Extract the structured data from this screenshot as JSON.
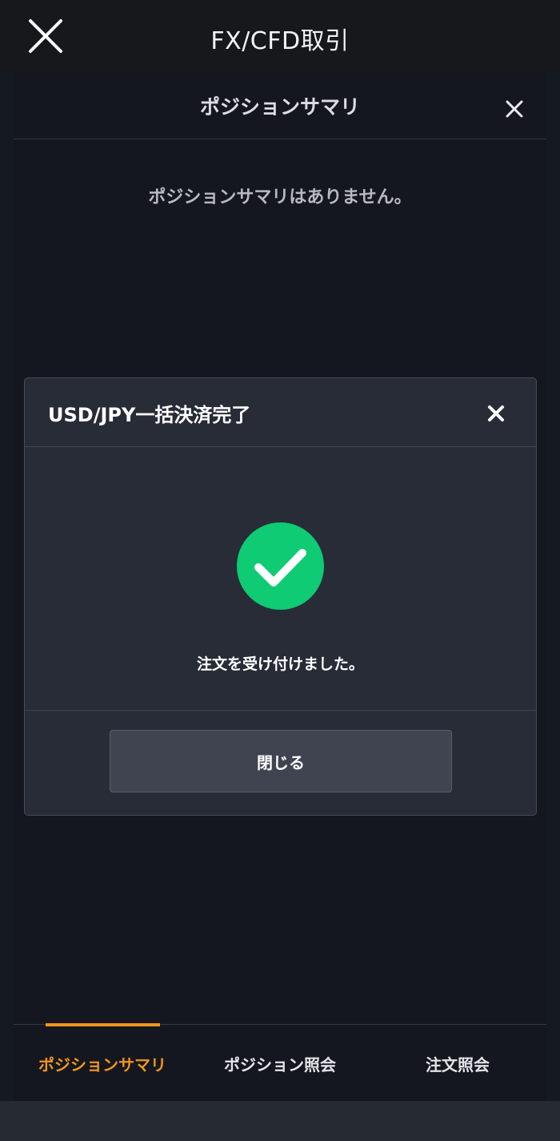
{
  "app": {
    "title": "FX/CFD取引"
  },
  "panel": {
    "title": "ポジションサマリ",
    "empty_message": "ポジションサマリはありません。"
  },
  "dialog": {
    "title": "USD/JPY一括決済完了",
    "message": "注文を受け付けました。",
    "close_label": "閉じる"
  },
  "tabs": [
    {
      "label": "ポジションサマリ",
      "active": true
    },
    {
      "label": "ポジション照会",
      "active": false
    },
    {
      "label": "注文照会",
      "active": false
    }
  ],
  "colors": {
    "accent": "#f0951e",
    "success": "#0ecb74"
  }
}
